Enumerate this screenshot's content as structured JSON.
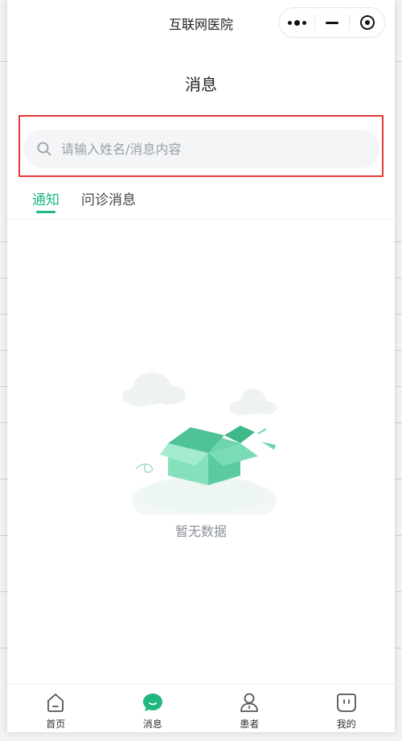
{
  "window": {
    "app_title": "互联网医院"
  },
  "header": {
    "page_title": "消息"
  },
  "search": {
    "placeholder": "请输入姓名/消息内容",
    "value": ""
  },
  "tabs": [
    {
      "label": "通知",
      "active": true
    },
    {
      "label": "问诊消息",
      "active": false
    }
  ],
  "empty_state": {
    "text": "暂无数据"
  },
  "tabbar": {
    "items": [
      {
        "label": "首页",
        "icon": "home-icon",
        "active": false
      },
      {
        "label": "消息",
        "icon": "message-bubble-icon",
        "active": true
      },
      {
        "label": "患者",
        "icon": "patient-icon",
        "active": false
      },
      {
        "label": "我的",
        "icon": "profile-icon",
        "active": false
      }
    ]
  },
  "colors": {
    "accent": "#1fb87f",
    "highlight": "#e53935",
    "search_bg": "#f4f5f7"
  }
}
